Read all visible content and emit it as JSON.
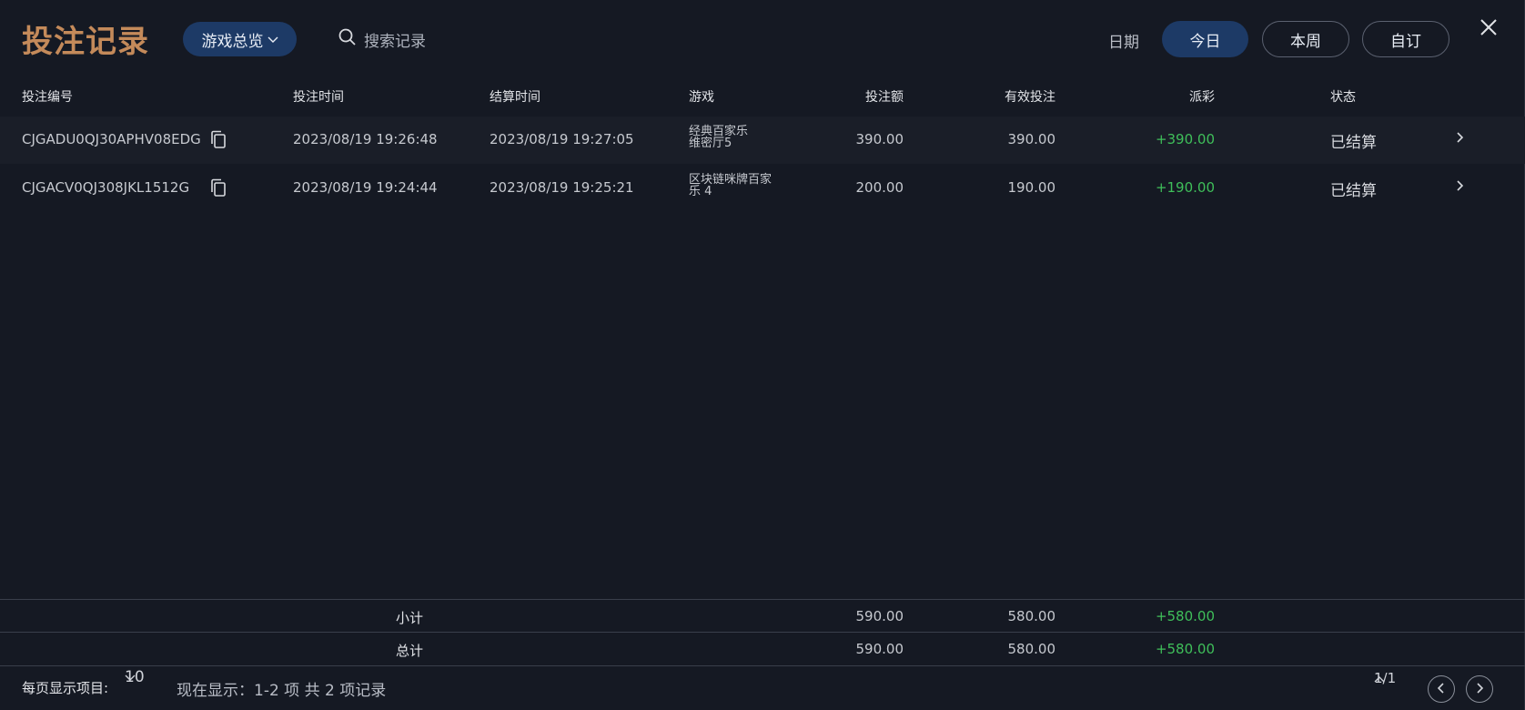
{
  "header": {
    "title": "投注记录",
    "game_filter": "游戏总览",
    "search_placeholder": "搜索记录",
    "date_label": "日期",
    "date_buttons": [
      "今日",
      "本周",
      "自订"
    ]
  },
  "table": {
    "columns": [
      "投注编号",
      "投注时间",
      "结算时间",
      "游戏",
      "投注额",
      "有效投注",
      "派彩",
      "状态"
    ],
    "rows": [
      {
        "id": "CJGADU0QJ30APHV08EDG",
        "bet_time": "2023/08/19 19:26:48",
        "settle_time": "2023/08/19 19:27:05",
        "game_line1": "经典百家乐",
        "game_line2": "维密厅5",
        "amount": "390.00",
        "valid": "390.00",
        "payout": "+390.00",
        "status": "已结算"
      },
      {
        "id": "CJGACV0QJ308JKL1512G",
        "bet_time": "2023/08/19 19:24:44",
        "settle_time": "2023/08/19 19:25:21",
        "game_line1": "区块链咪牌百家",
        "game_line2": "乐 4",
        "amount": "200.00",
        "valid": "190.00",
        "payout": "+190.00",
        "status": "已结算"
      }
    ]
  },
  "subtotal": {
    "label": "小计",
    "amount": "590.00",
    "valid": "580.00",
    "payout": "+580.00"
  },
  "total": {
    "label": "总计",
    "amount": "590.00",
    "valid": "580.00",
    "payout": "+580.00"
  },
  "footer": {
    "per_page_label": "每页显示项目:",
    "per_page_value": "10",
    "showing": "现在显示：1-2 项 共 2 项记录",
    "page": "1/1"
  },
  "colors": {
    "accent": "#c48a5a",
    "active_pill": "#1d3a66",
    "payout_green": "#3fbf5a"
  }
}
